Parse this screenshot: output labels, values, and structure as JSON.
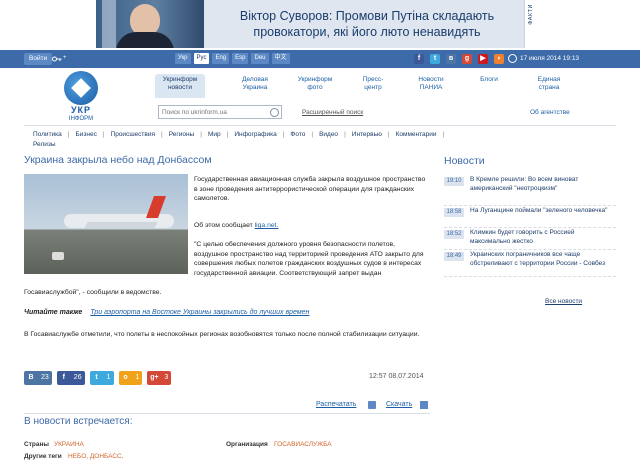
{
  "banner": {
    "headline": "Віктор Суворов: Промови Путіна складають провокатори, які його люто ненавидять",
    "side_label": "ФАКТИ"
  },
  "topbar": {
    "login_label": "Войти",
    "plus": "+",
    "languages": [
      "Укр",
      "Рус",
      "Eng",
      "Esp",
      "Deu",
      "中文"
    ],
    "active_language": "Рус",
    "socials": [
      {
        "name": "facebook-icon",
        "glyph": "f",
        "color": "#3b5998"
      },
      {
        "name": "twitter-icon",
        "glyph": "t",
        "color": "#3ea9dd"
      },
      {
        "name": "vk-icon",
        "glyph": "в",
        "color": "#4c75a3"
      },
      {
        "name": "google-plus-icon",
        "glyph": "g",
        "color": "#d34836"
      },
      {
        "name": "youtube-icon",
        "glyph": "▶",
        "color": "#cc181e"
      },
      {
        "name": "rss-icon",
        "glyph": "◗",
        "color": "#ee802f"
      }
    ],
    "datetime": "17 июля 2014 19:13"
  },
  "logo": {
    "title": "УКР",
    "subtitle": "ІНФОРМ"
  },
  "main_nav": [
    {
      "line1": "Укринформ",
      "line2": "новости"
    },
    {
      "line1": "Деловая",
      "line2": "Украина"
    },
    {
      "line1": "Укринформ",
      "line2": "фото"
    },
    {
      "line1": "Пресс-",
      "line2": "центр"
    },
    {
      "line1": "Новости",
      "line2": "ПАНИА"
    },
    {
      "line1": "Блоги",
      "line2": ""
    },
    {
      "line1": "Единая",
      "line2": "страна"
    }
  ],
  "search": {
    "placeholder": "Поиск по ukrinform.ua",
    "advanced": "Расширенный поиск"
  },
  "about_link": "Об агентстве",
  "categories": [
    "Политика",
    "Бизнес",
    "Происшествия",
    "Регионы",
    "Мир",
    "Инфографика",
    "Фото",
    "Видео",
    "Интервью",
    "Комментарии",
    "Релизы"
  ],
  "article": {
    "title": "Украина закрыла небо над Донбассом",
    "p1": "Государственная авиационная служба закрыла воздушное пространство в зоне проведения антитеррористической операции для гражданских самолетов.",
    "p2_prefix": "Об этом сообщает",
    "p2_link": "liga.net.",
    "p3": "\"С целью обеспечения должного уровня безопасности полетов, воздушное пространство над территорией проведения АТО закрыто для совершения любых полетов гражданских воздушных судов в интересах государственной авиации. Соответствующий запрет выдан",
    "p3b": "Госавиаслужбой\", - сообщили в ведомстве.",
    "read_also_label": "Читайте также",
    "read_also_link": "Три аэропорта на Востоке Украины закрылись до лучших времен",
    "p4": "В Госавиаслужбе отметили, что полеты в неспокойных регионах возобновятся только после полной стабилизации ситуации.",
    "time": "12:57  08.07.2014",
    "print": "Распечатать",
    "download": "Скачать"
  },
  "shares": [
    {
      "name": "vk-share",
      "glyph": "В",
      "count": "23",
      "color": "#4c75a3"
    },
    {
      "name": "facebook-share",
      "glyph": "f",
      "count": "26",
      "color": "#3b5998"
    },
    {
      "name": "twitter-share",
      "glyph": "t",
      "count": "1",
      "color": "#3ea9dd"
    },
    {
      "name": "odnoklassniki-share",
      "glyph": "о",
      "count": "1",
      "color": "#f0a21b"
    },
    {
      "name": "google-plus-share",
      "glyph": "g+",
      "count": "3",
      "color": "#d34836"
    }
  ],
  "also_title": "В новости встречается:",
  "tags": {
    "countries_label": "Страны",
    "countries": "УКРАИНА",
    "orgs_label": "Организация",
    "orgs": "ГОСАВИАСЛУЖБА",
    "other_label": "Другие теги",
    "other": "НЕБО, ДОНБАСС,"
  },
  "news": {
    "title": "Новости",
    "items": [
      {
        "time": "19:10",
        "text": "В Кремле решили: Во всем виноват американский \"неотроцкизм\""
      },
      {
        "time": "18:58",
        "text": "На Луганщине поймали \"зеленого человечка\""
      },
      {
        "time": "18:52",
        "text": "Климкин будет говорить с Россией максимально жестко"
      },
      {
        "time": "18:49",
        "text": "Украинских пограничников все чаще обстреливают с территории России - Совбез"
      }
    ],
    "all": "Все новости"
  }
}
